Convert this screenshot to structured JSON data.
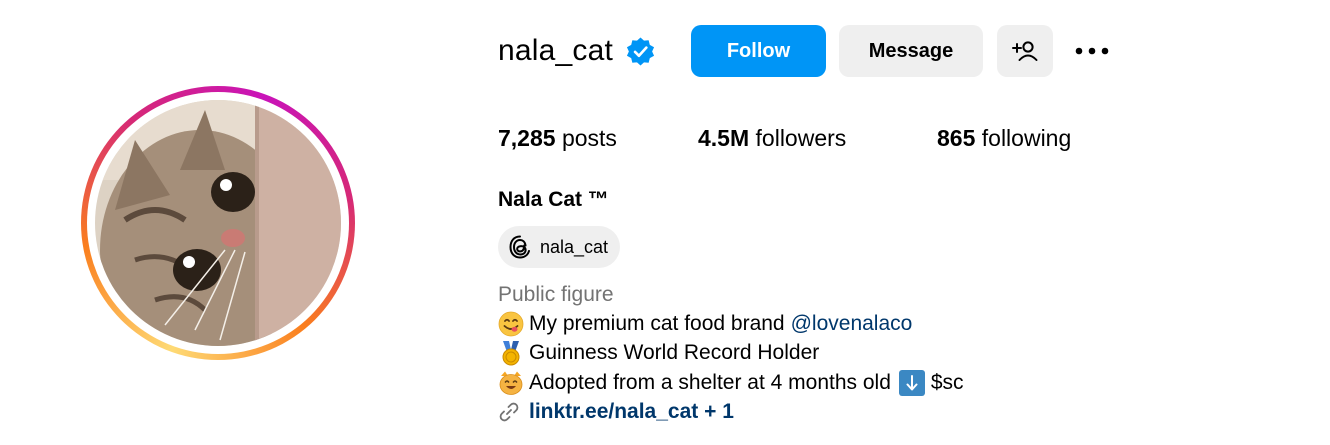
{
  "profile": {
    "username": "nala_cat",
    "verified": true,
    "full_name": "Nala Cat ™",
    "threads_handle": "nala_cat",
    "category": "Public figure"
  },
  "actions": {
    "follow_label": "Follow",
    "message_label": "Message"
  },
  "stats": {
    "posts_count": "7,285",
    "posts_label": "posts",
    "followers_count": "4.5M",
    "followers_label": "followers",
    "following_count": "865",
    "following_label": "following"
  },
  "bio": {
    "line1_text": "My premium cat food brand",
    "line1_mention": "@lovenalaco",
    "line1_emoji": "yum-face-icon",
    "line2_text": "Guinness World Record Holder",
    "line2_emoji": "medal-icon",
    "line3_text": "Adopted from a shelter at 4 months old",
    "line3_after": "$sc",
    "line3_emoji": "smiling-cat-icon"
  },
  "link": {
    "text": "linktr.ee/nala_cat + 1",
    "icon": "link-icon"
  },
  "colors": {
    "follow_button": "#0095f6",
    "verified_badge": "#0095f6",
    "link_text": "#00376b",
    "secondary_button": "#efefef",
    "muted_text": "#737373"
  }
}
